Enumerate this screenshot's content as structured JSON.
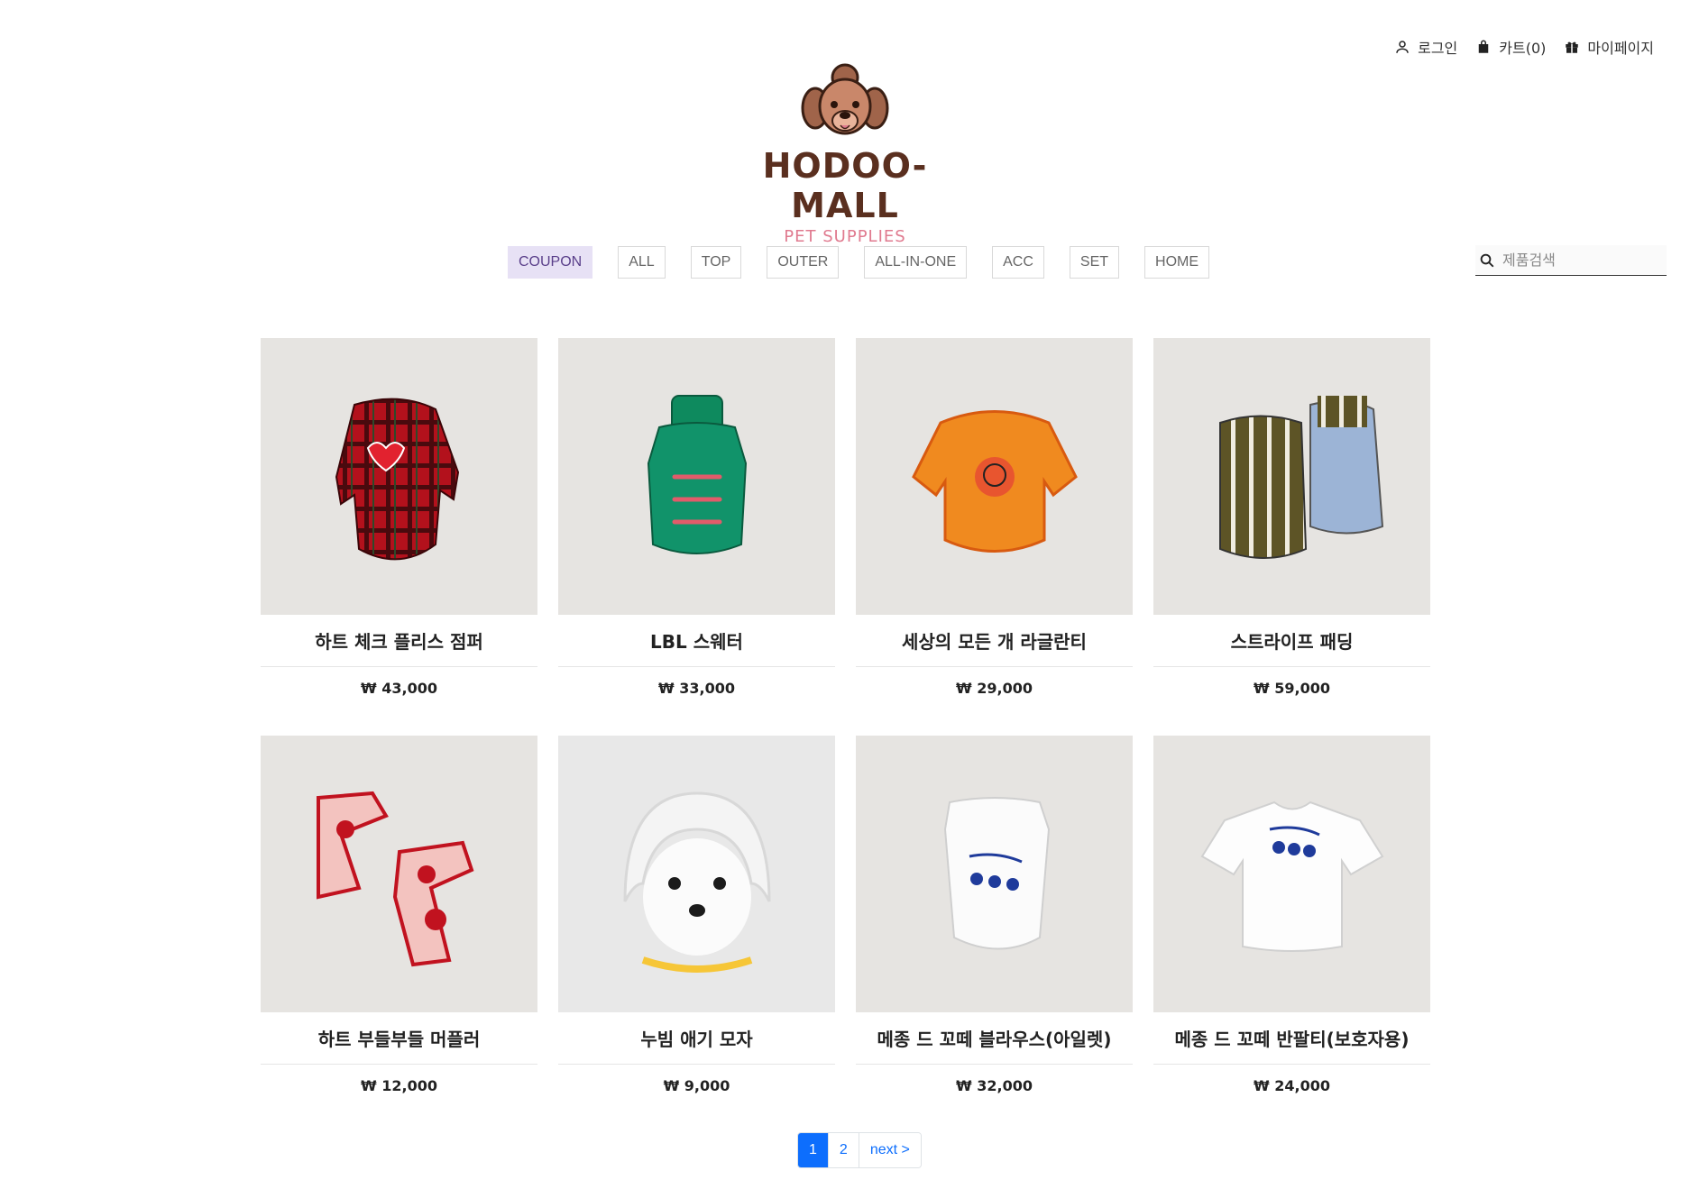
{
  "header": {
    "login_label": "로그인",
    "cart_label": "카트(0)",
    "mypage_label": "마이페이지"
  },
  "logo": {
    "title": "HODOO-MALL",
    "subtitle": "PET SUPPLIES"
  },
  "nav": {
    "items": [
      {
        "label": "COUPON",
        "active": true
      },
      {
        "label": "ALL"
      },
      {
        "label": "TOP"
      },
      {
        "label": "OUTER"
      },
      {
        "label": "ALL-IN-ONE"
      },
      {
        "label": "ACC"
      },
      {
        "label": "SET"
      },
      {
        "label": "HOME"
      }
    ]
  },
  "search": {
    "placeholder": "제품검색"
  },
  "products": [
    {
      "name": "하트 체크 플리스 점퍼",
      "price": "₩ 43,000",
      "image_icon": "red-plaid-jumper-image"
    },
    {
      "name": "LBL 스웨터",
      "price": "₩ 33,000",
      "image_icon": "green-sweater-image"
    },
    {
      "name": "세상의 모든 개 라글란티",
      "price": "₩ 29,000",
      "image_icon": "orange-raglan-tee-image"
    },
    {
      "name": "스트라이프 패딩",
      "price": "₩ 59,000",
      "image_icon": "striped-padding-image"
    },
    {
      "name": "하트 부들부들 머플러",
      "price": "₩ 12,000",
      "image_icon": "heart-muffler-image"
    },
    {
      "name": "누빔 애기 모자",
      "price": "₩ 9,000",
      "image_icon": "quilted-hat-dog-image"
    },
    {
      "name": "메종 드 꼬떼 블라우스(아일렛)",
      "price": "₩ 32,000",
      "image_icon": "white-blouse-image"
    },
    {
      "name": "메종 드 꼬떼 반팔티(보호자용)",
      "price": "₩ 24,000",
      "image_icon": "white-tshirt-image"
    }
  ],
  "pagination": {
    "pages": [
      "1",
      "2"
    ],
    "current": "1",
    "next_label": "next >"
  },
  "colors": {
    "accent": "#0d6efd",
    "nav_active_bg": "#e7e1f5",
    "logo_brown": "#5a2f1f",
    "logo_pink": "#e07a8f",
    "image_bg": "#e6e4e1"
  }
}
